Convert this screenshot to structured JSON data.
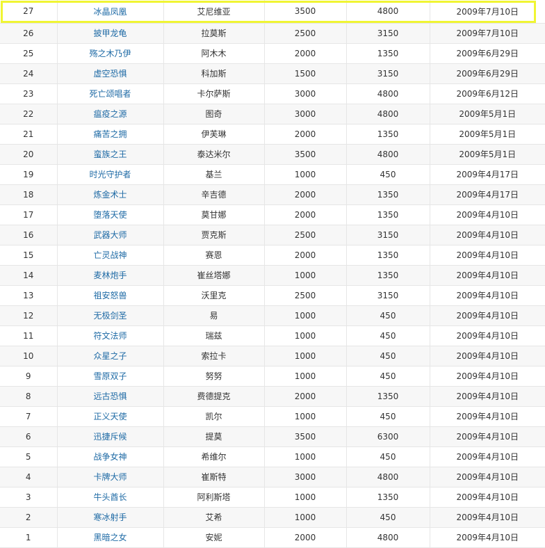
{
  "table": {
    "rows": [
      {
        "id": "27",
        "name": "冰晶凤凰",
        "voice": "艾尼维亚",
        "gold": "3500",
        "tickets": "4800",
        "date": "2009年7月10日"
      },
      {
        "id": "26",
        "name": "披甲龙龟",
        "voice": "拉莫斯",
        "gold": "2500",
        "tickets": "3150",
        "date": "2009年7月10日"
      },
      {
        "id": "25",
        "name": "殇之木乃伊",
        "voice": "阿木木",
        "gold": "2000",
        "tickets": "1350",
        "date": "2009年6月29日"
      },
      {
        "id": "24",
        "name": "虚空恐惧",
        "voice": "科加斯",
        "gold": "1500",
        "tickets": "3150",
        "date": "2009年6月29日"
      },
      {
        "id": "23",
        "name": "死亡颂唱者",
        "voice": "卡尔萨斯",
        "gold": "3000",
        "tickets": "4800",
        "date": "2009年6月12日"
      },
      {
        "id": "22",
        "name": "瘟疫之源",
        "voice": "图奇",
        "gold": "3000",
        "tickets": "4800",
        "date": "2009年5月1日"
      },
      {
        "id": "21",
        "name": "痛苦之拥",
        "voice": "伊芙琳",
        "gold": "2000",
        "tickets": "1350",
        "date": "2009年5月1日"
      },
      {
        "id": "20",
        "name": "蛮族之王",
        "voice": "泰达米尔",
        "gold": "3500",
        "tickets": "4800",
        "date": "2009年5月1日"
      },
      {
        "id": "19",
        "name": "时光守护者",
        "voice": "基兰",
        "gold": "1000",
        "tickets": "450",
        "date": "2009年4月17日"
      },
      {
        "id": "18",
        "name": "炼金术士",
        "voice": "辛吉德",
        "gold": "2000",
        "tickets": "1350",
        "date": "2009年4月17日"
      },
      {
        "id": "17",
        "name": "堕落天使",
        "voice": "莫甘娜",
        "gold": "2000",
        "tickets": "1350",
        "date": "2009年4月10日"
      },
      {
        "id": "16",
        "name": "武器大师",
        "voice": "贾克斯",
        "gold": "2500",
        "tickets": "3150",
        "date": "2009年4月10日"
      },
      {
        "id": "15",
        "name": "亡灵战神",
        "voice": "赛恩",
        "gold": "2000",
        "tickets": "1350",
        "date": "2009年4月10日"
      },
      {
        "id": "14",
        "name": "麦林炮手",
        "voice": "崔丝塔娜",
        "gold": "1000",
        "tickets": "1350",
        "date": "2009年4月10日"
      },
      {
        "id": "13",
        "name": "祖安怒兽",
        "voice": "沃里克",
        "gold": "2500",
        "tickets": "3150",
        "date": "2009年4月10日"
      },
      {
        "id": "12",
        "name": "无极剑圣",
        "voice": "易",
        "gold": "1000",
        "tickets": "450",
        "date": "2009年4月10日"
      },
      {
        "id": "11",
        "name": "符文法师",
        "voice": "瑞兹",
        "gold": "1000",
        "tickets": "450",
        "date": "2009年4月10日"
      },
      {
        "id": "10",
        "name": "众星之子",
        "voice": "索拉卡",
        "gold": "1000",
        "tickets": "450",
        "date": "2009年4月10日"
      },
      {
        "id": "9",
        "name": "雪原双子",
        "voice": "努努",
        "gold": "1000",
        "tickets": "450",
        "date": "2009年4月10日"
      },
      {
        "id": "8",
        "name": "远古恐惧",
        "voice": "费德提克",
        "gold": "2000",
        "tickets": "1350",
        "date": "2009年4月10日"
      },
      {
        "id": "7",
        "name": "正义天使",
        "voice": "凯尔",
        "gold": "1000",
        "tickets": "450",
        "date": "2009年4月10日"
      },
      {
        "id": "6",
        "name": "迅捷斥候",
        "voice": "提莫",
        "gold": "3500",
        "tickets": "6300",
        "date": "2009年4月10日"
      },
      {
        "id": "5",
        "name": "战争女神",
        "voice": "希维尔",
        "gold": "1000",
        "tickets": "450",
        "date": "2009年4月10日"
      },
      {
        "id": "4",
        "name": "卡牌大师",
        "voice": "崔斯特",
        "gold": "3000",
        "tickets": "4800",
        "date": "2009年4月10日"
      },
      {
        "id": "3",
        "name": "牛头酋长",
        "voice": "阿利斯塔",
        "gold": "1000",
        "tickets": "1350",
        "date": "2009年4月10日"
      },
      {
        "id": "2",
        "name": "寒冰射手",
        "voice": "艾希",
        "gold": "1000",
        "tickets": "450",
        "date": "2009年4月10日"
      },
      {
        "id": "1",
        "name": "黑暗之女",
        "voice": "安妮",
        "gold": "2000",
        "tickets": "4800",
        "date": "2009年4月10日"
      }
    ]
  },
  "highlight": {
    "row_id": "27",
    "color": "#f0f533"
  },
  "colors": {
    "link": "#1e6aa5",
    "text": "#333333",
    "border": "#e6e6e6",
    "stripe": "#f7f7f7"
  }
}
